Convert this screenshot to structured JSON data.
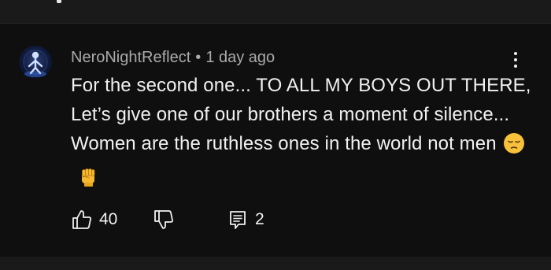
{
  "comment": {
    "author": "NeroNightReflect",
    "separator": "•",
    "time": "1 day ago",
    "text": "For the second one... TO ALL MY BOYS OUT THERE, Let’s give one of our brothers a moment of silence... Women are the ruthless ones in the world not men",
    "emojis": [
      "pensive-face-emoji",
      "raised-fist-emoji"
    ],
    "likes": "40",
    "replies": "2"
  },
  "icons": {
    "like": "thumbs-up-icon",
    "dislike": "thumbs-down-icon",
    "reply": "reply-comment-icon",
    "menu": "more-vert-icon"
  },
  "colors": {
    "background": "#0f0f0f",
    "text": "#f1f1f1",
    "meta": "#aaaaaa"
  }
}
